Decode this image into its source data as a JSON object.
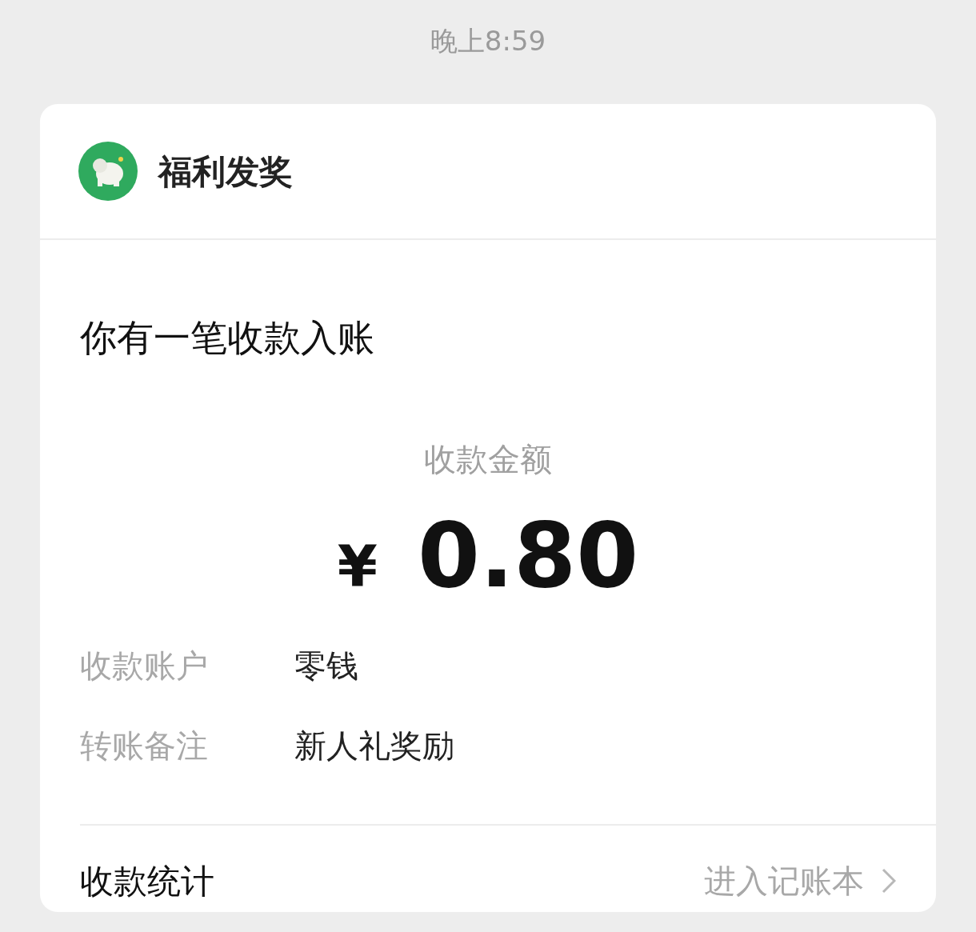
{
  "time": "晚上8:59",
  "sender": {
    "name": "福利发奖"
  },
  "headline": "你有一笔收款入账",
  "amount": {
    "label": "收款金额",
    "currency": "¥",
    "value": "0.80"
  },
  "details": [
    {
      "label": "收款账户",
      "value": "零钱"
    },
    {
      "label": "转账备注",
      "value": "新人礼奖励"
    }
  ],
  "footer": {
    "label": "收款统计",
    "link": "进入记账本"
  }
}
